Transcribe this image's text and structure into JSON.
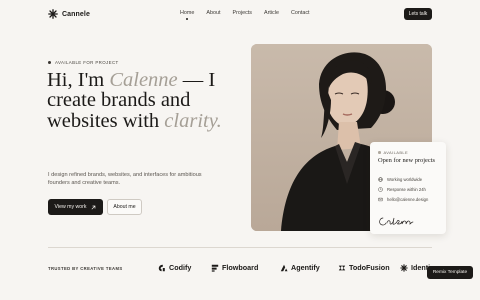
{
  "brand": {
    "name": "Cannele"
  },
  "nav": {
    "links": [
      "Home",
      "About",
      "Projects",
      "Article",
      "Contact"
    ],
    "cta": "Lets talk"
  },
  "hero": {
    "eyebrow": "AVAILABLE FOR PROJECT",
    "headline": {
      "part1": "Hi, I'm ",
      "name": "Calenne",
      "part2": " — I create brands and websites with ",
      "accent": "clarity."
    },
    "lede": "I design refined brands, websites, and interfaces for ambitious founders and creative teams.",
    "primary_button": "View my work",
    "secondary_button": "About me"
  },
  "card": {
    "status": "AVAILABLE",
    "title": "Open for new projects",
    "rows": [
      "Working worldwide",
      "Response within 24h",
      "hello@calenne.design"
    ],
    "signature": "Calenne"
  },
  "trusted": {
    "label": "TRUSTED BY CREATIVE TEAMS",
    "logos": [
      "Codify",
      "Flowboard",
      "Agentify",
      "TodoFusion",
      "Identi"
    ]
  },
  "remix": {
    "label": "Remix Template"
  },
  "colors": {
    "accent": "#1c1a18",
    "background": "#f7f5f2",
    "muted": "#a59f96"
  }
}
